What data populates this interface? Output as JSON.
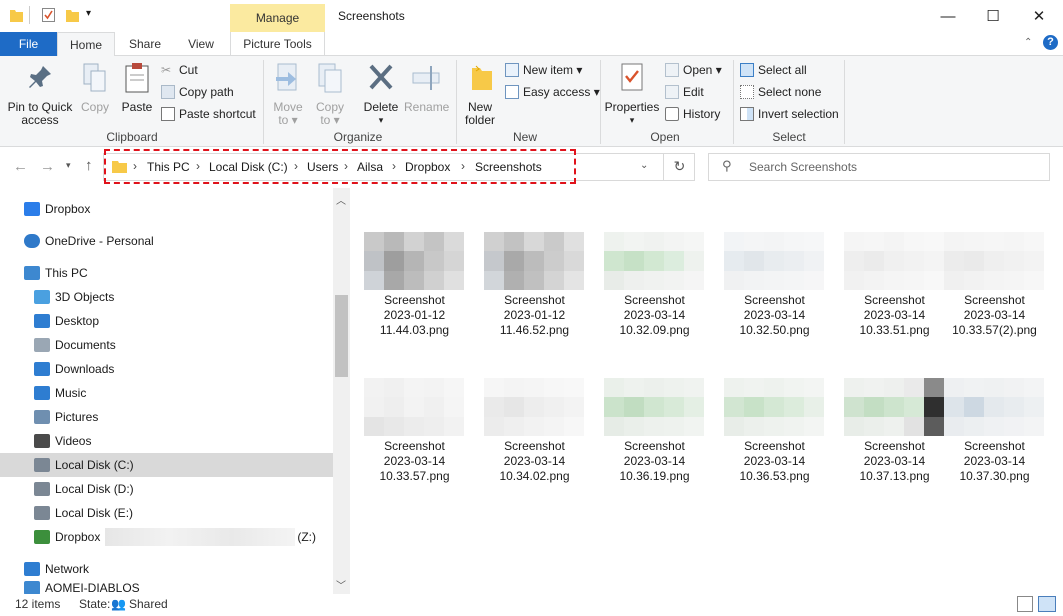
{
  "window": {
    "title": "Screenshots",
    "manage_tab": "Manage",
    "controls": [
      "—",
      "☐",
      "✕"
    ]
  },
  "tabs": [
    "File",
    "Home",
    "Share",
    "View",
    "Picture Tools"
  ],
  "ribbon": {
    "clipboard": {
      "label": "Clipboard",
      "pin": [
        "Pin to Quick",
        "access"
      ],
      "copy": "Copy",
      "paste": "Paste",
      "cut": "Cut",
      "copy_path": "Copy path",
      "paste_shortcut": "Paste shortcut"
    },
    "organize": {
      "label": "Organize",
      "move_to": [
        "Move",
        "to ▾"
      ],
      "copy_to": [
        "Copy",
        "to ▾"
      ],
      "delete": [
        "Delete",
        "▾"
      ],
      "rename": "Rename"
    },
    "new": {
      "label": "New",
      "new_folder": [
        "New",
        "folder"
      ],
      "new_item": "New item ▾",
      "easy_access": "Easy access ▾"
    },
    "open": {
      "label": "Open",
      "properties": [
        "Properties",
        "▾"
      ],
      "open": "Open ▾",
      "edit": "Edit",
      "history": "History"
    },
    "select": {
      "label": "Select",
      "select_all": "Select all",
      "select_none": "Select none",
      "invert": "Invert selection"
    }
  },
  "address": {
    "crumbs": [
      "This PC",
      "Local Disk (C:)",
      "Users",
      "Ailsa",
      "Dropbox",
      "Screenshots"
    ],
    "search_placeholder": "Search Screenshots"
  },
  "nav": [
    {
      "label": "Dropbox",
      "icon": "dropbox-icon"
    },
    {
      "label": "OneDrive - Personal",
      "icon": "cloud-icon"
    },
    {
      "label": "This PC",
      "icon": "pc-icon"
    },
    {
      "label": "3D Objects",
      "icon": "cube-icon"
    },
    {
      "label": "Desktop",
      "icon": "desktop-icon"
    },
    {
      "label": "Documents",
      "icon": "documents-icon"
    },
    {
      "label": "Downloads",
      "icon": "download-icon"
    },
    {
      "label": "Music",
      "icon": "music-icon"
    },
    {
      "label": "Pictures",
      "icon": "pictures-icon"
    },
    {
      "label": "Videos",
      "icon": "videos-icon"
    },
    {
      "label": "Local Disk (C:)",
      "icon": "drive-icon"
    },
    {
      "label": "Local Disk (D:)",
      "icon": "drive-icon"
    },
    {
      "label": "Local Disk (E:)",
      "icon": "drive-icon"
    },
    {
      "label": "Dropbox",
      "suffix": "(Z:)",
      "icon": "network-drive-icon"
    },
    {
      "label": "Network",
      "icon": "network-icon"
    },
    {
      "label": "AOMEI-DIABLOS",
      "icon": "computer-icon"
    }
  ],
  "files": [
    {
      "l1": "Screenshot",
      "l2": "2023-01-12",
      "l3": "11.44.03.png"
    },
    {
      "l1": "Screenshot",
      "l2": "2023-01-12",
      "l3": "11.46.52.png"
    },
    {
      "l1": "Screenshot",
      "l2": "2023-03-14",
      "l3": "10.32.09.png"
    },
    {
      "l1": "Screenshot",
      "l2": "2023-03-14",
      "l3": "10.32.50.png"
    },
    {
      "l1": "Screenshot",
      "l2": "2023-03-14",
      "l3": "10.33.51.png"
    },
    {
      "l1": "Screenshot",
      "l2": "2023-03-14",
      "l3": "10.33.57(2).png"
    },
    {
      "l1": "Screenshot",
      "l2": "2023-03-14",
      "l3": "10.33.57.png"
    },
    {
      "l1": "Screenshot",
      "l2": "2023-03-14",
      "l3": "10.34.02.png"
    },
    {
      "l1": "Screenshot",
      "l2": "2023-03-14",
      "l3": "10.36.19.png"
    },
    {
      "l1": "Screenshot",
      "l2": "2023-03-14",
      "l3": "10.36.53.png"
    },
    {
      "l1": "Screenshot",
      "l2": "2023-03-14",
      "l3": "10.37.13.png"
    },
    {
      "l1": "Screenshot",
      "l2": "2023-03-14",
      "l3": "10.37.30.png"
    }
  ],
  "status": {
    "count": "12 items",
    "state_label": "State:",
    "state_value": "Shared"
  },
  "colors": {
    "accent": "#1e6bc6",
    "manage": "#fbeaa0",
    "highlight": "#e0121b"
  }
}
